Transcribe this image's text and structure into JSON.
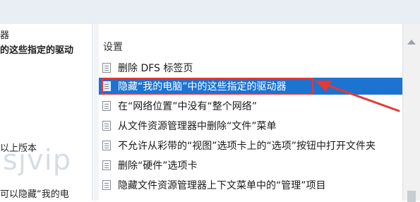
{
  "left_pane": {
    "tab_fragment": "器",
    "lines": [
      {
        "text": "的这些指定的驱动",
        "bold": true
      },
      {
        "text": "以上版本",
        "bold": false
      },
      {
        "text": "可以隐藏“我的电",
        "bold": false
      }
    ],
    "watermark": "sjvip"
  },
  "list": {
    "header": "设置",
    "items": [
      {
        "label": "删除 DFS 标签页",
        "selected": false
      },
      {
        "label": "隐藏“我的电脑”中的这些指定的驱动器",
        "selected": true
      },
      {
        "label": "在“网络位置”中没有“整个网络”",
        "selected": false
      },
      {
        "label": "从文件资源管理器中删除“文件”菜单",
        "selected": false
      },
      {
        "label": "不允许从彩带的“视图”选项卡上的“选项”按钮中打开文件夹",
        "selected": false
      },
      {
        "label": "删除“硬件”选项卡",
        "selected": false
      },
      {
        "label": "隐藏文件资源管理器上下文菜单中的“管理”项目",
        "selected": false
      }
    ]
  },
  "colors": {
    "selection": "#1d73d0",
    "annotation": "#e53935"
  }
}
